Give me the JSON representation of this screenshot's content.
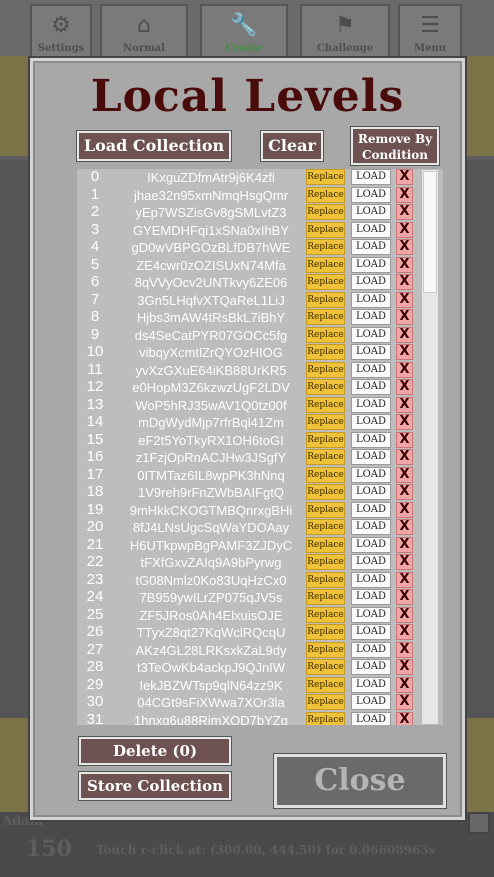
{
  "top_tabs": [
    {
      "label": "Settings",
      "icon": "gear-icon"
    },
    {
      "label": "Normal",
      "icon": "home-icon"
    },
    {
      "label": "Create",
      "icon": "wrench-icon"
    },
    {
      "label": "Challenge",
      "icon": "flag-icon"
    },
    {
      "label": "Menu",
      "icon": "menu-icon"
    }
  ],
  "dialog": {
    "title": "Local Levels",
    "load_collection_label": "Load Collection",
    "clear_label": "Clear",
    "remove_by_condition_label": "Remove By Condition",
    "delete_label": "Delete (0)",
    "store_collection_label": "Store Collection",
    "close_label": "Close",
    "row_replace_label": "Replace",
    "row_load_label": "LOAD",
    "row_delete_label": "X"
  },
  "levels": [
    {
      "index": "0",
      "code": "IKxguZDfmAtr9j6K4zfi"
    },
    {
      "index": "1",
      "code": "jhae32n95xmNmqHsgQmr"
    },
    {
      "index": "2",
      "code": "yEp7WSZisGv8gSMLvtZ3"
    },
    {
      "index": "3",
      "code": "GYEMDHFqi1xSNa0xIhBY"
    },
    {
      "index": "4",
      "code": "gD0wVBPGOzBLfDB7hWE"
    },
    {
      "index": "5",
      "code": "ZE4cwr0zOZISUxN74Mfa"
    },
    {
      "index": "6",
      "code": "8qVVyOcv2UNTkvy6ZE06"
    },
    {
      "index": "7",
      "code": "3Gn5LHqfvXTQaReL1LiJ"
    },
    {
      "index": "8",
      "code": "Hjbs3mAW4tRsBkL7iBhY"
    },
    {
      "index": "9",
      "code": "ds4SeCatPYR07GOCc5fg"
    },
    {
      "index": "10",
      "code": "vibqyXcmtlZrQYOzHIOG"
    },
    {
      "index": "11",
      "code": "yvXzGXuE64iKB88UrKR5"
    },
    {
      "index": "12",
      "code": "e0HopM3Z6kzwzUgF2LDV"
    },
    {
      "index": "13",
      "code": "WoP5hRJ35wAV1Q0tz00f"
    },
    {
      "index": "14",
      "code": "mDgWydMjp7rfrBql41Zm"
    },
    {
      "index": "15",
      "code": "eF2t5YoTkyRX1OH6toGI"
    },
    {
      "index": "16",
      "code": "z1FzjOpRnACJHw3JSgfY"
    },
    {
      "index": "17",
      "code": "0ITMTaz6IL8wpPK3hNnq"
    },
    {
      "index": "18",
      "code": "1V9reh9rFnZWbBAIFgtQ"
    },
    {
      "index": "19",
      "code": "9mHkkCKOGTMBQnrxgBHi"
    },
    {
      "index": "20",
      "code": "8fJ4LNsUgcSqWaYDOAay"
    },
    {
      "index": "21",
      "code": "H6UTkpwpBgPAMF3ZJDyC"
    },
    {
      "index": "22",
      "code": "tFXfGxvZAIq9A9bPyrwg"
    },
    {
      "index": "23",
      "code": "tG08Nmlz0Ko83UqHzCx0"
    },
    {
      "index": "24",
      "code": "7B959ywILrZP075qJV5s"
    },
    {
      "index": "25",
      "code": "ZF5JRos0Ah4ElxuisOJE"
    },
    {
      "index": "26",
      "code": "TTyxZ8qt27KqWclRQcqU"
    },
    {
      "index": "27",
      "code": "AKz4GL28LRKsxkZaL9dy"
    },
    {
      "index": "28",
      "code": "t3TeOwKb4ackpJ9QJnIW"
    },
    {
      "index": "29",
      "code": "IekJBZWTsp9qlN64zz9K"
    },
    {
      "index": "30",
      "code": "04CGt9sFiXWwa7XOr3la"
    },
    {
      "index": "31",
      "code": "1hnxq6u88RimXOD7bYZq"
    }
  ],
  "status": {
    "player_name": "Adam",
    "score": "150",
    "debug_text": "Touch r-click at: (300.00, 444.50) for 0.06608963s"
  },
  "colors": {
    "title": "#4a0b0b",
    "replace_button": "#f0c23a",
    "delete_button": "#f0a6a6",
    "maroon_button": "#6e5252",
    "active_tab": "#3f8f3f"
  }
}
